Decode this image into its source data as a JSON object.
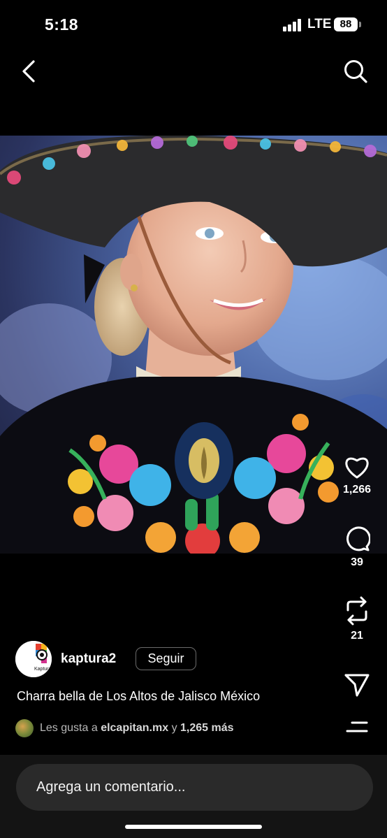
{
  "status_bar": {
    "time": "5:18",
    "network": "LTE",
    "battery": "88"
  },
  "nav": {
    "back_icon": "chevron-left-icon",
    "search_icon": "search-icon"
  },
  "post": {
    "username": "kaptura2",
    "avatar_label": "Kaptura",
    "follow_label": "Seguir",
    "caption": "Charra bella de Los Altos de Jalisco México",
    "likes": {
      "prefix": "Les gusta a",
      "user": "elcapitan.mx",
      "connector": "y",
      "others": "1,265 más"
    }
  },
  "actions": {
    "like": {
      "icon": "heart-icon",
      "count": "1,266"
    },
    "comment": {
      "icon": "comment-bubble-icon",
      "count": "39"
    },
    "repost": {
      "icon": "repost-icon",
      "count": "21"
    },
    "share": {
      "icon": "paper-plane-icon"
    },
    "more": {
      "icon": "menu-lines-icon"
    }
  },
  "comment_box": {
    "placeholder": "Agrega un comentario..."
  },
  "colors": {
    "background": "#000000",
    "comment_bar": "#141414",
    "input": "#2a2a2a"
  }
}
